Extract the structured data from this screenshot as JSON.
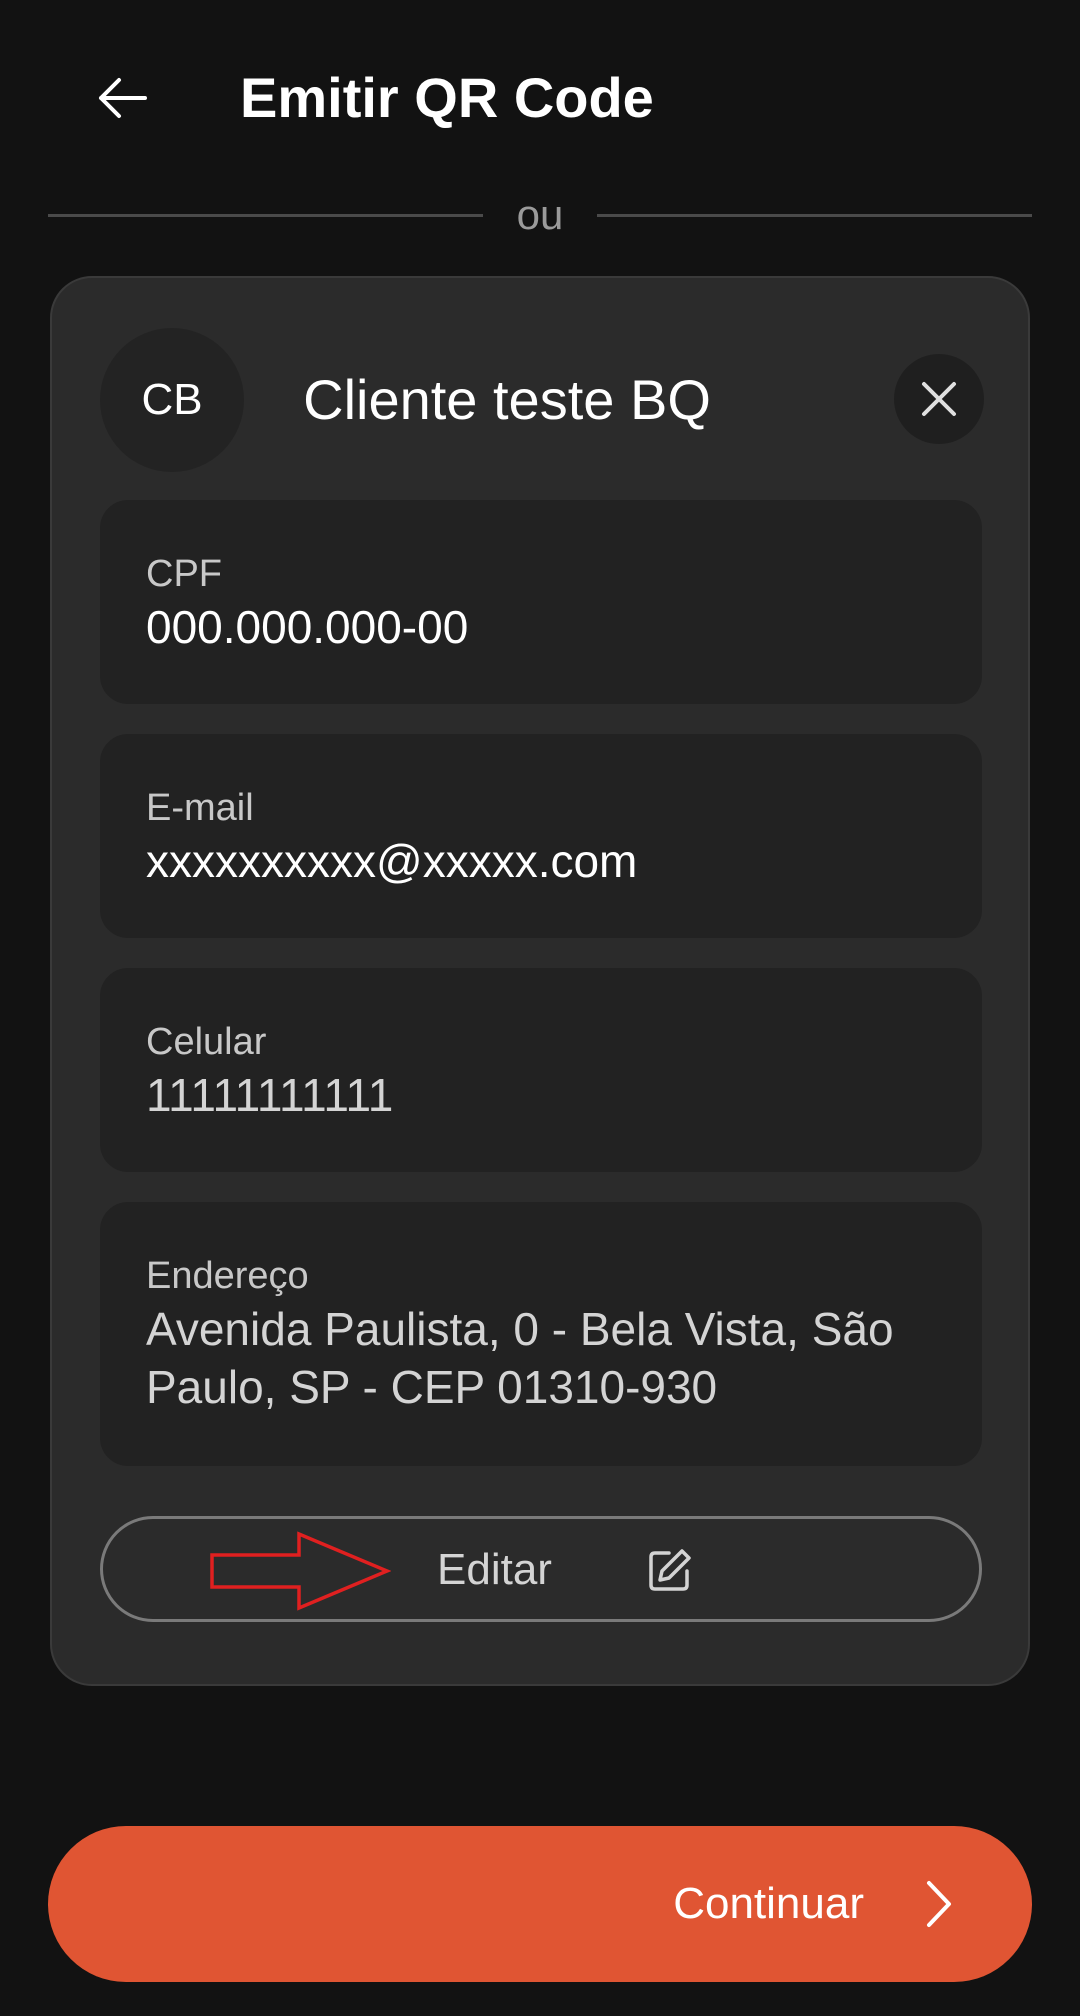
{
  "header": {
    "title": "Emitir QR Code"
  },
  "divider": {
    "text": "ou"
  },
  "client_card": {
    "avatar_initials": "CB",
    "name": "Cliente teste BQ",
    "fields": [
      {
        "label": "CPF",
        "value": "000.000.000-00"
      },
      {
        "label": "E-mail",
        "value": "xxxxxxxxxx@xxxxx.com"
      },
      {
        "label": "Celular",
        "value": "11111111111"
      },
      {
        "label": "Endereço",
        "value_line1": "Avenida Paulista, 0  - Bela Vista, São",
        "value_line2": "Paulo, SP - CEP 01310-930"
      }
    ],
    "edit_label": "Editar"
  },
  "footer": {
    "continue_label": "Continuar"
  },
  "icons": {
    "back": "arrow-left-icon",
    "close": "close-icon",
    "edit": "edit-icon",
    "continue": "chevron-right-icon",
    "annotation": "red-arrow-annotation"
  },
  "colors": {
    "background": "#121212",
    "card": "#2b2b2b",
    "field": "#222222",
    "accent": "#e05533",
    "annotation": "#e02020"
  }
}
